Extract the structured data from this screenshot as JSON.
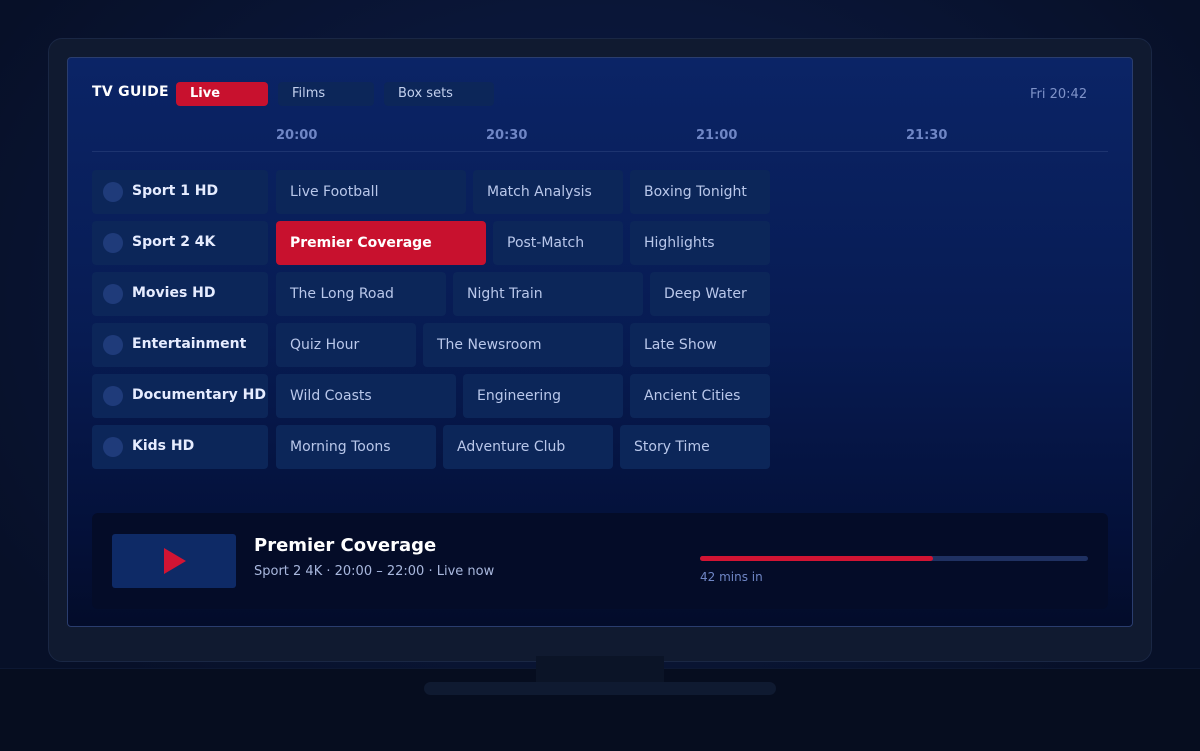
{
  "guide": {
    "title": "TV GUIDE",
    "tabs": [
      {
        "label": "Live",
        "active": true
      },
      {
        "label": "Films",
        "active": false
      },
      {
        "label": "Box sets",
        "active": false
      }
    ],
    "clock": "Fri 20:42"
  },
  "timeline": [
    "20:00",
    "20:30",
    "21:00",
    "21:30"
  ],
  "channels": [
    {
      "name": "Sport 1 HD",
      "programs": [
        "Live Football",
        "Match Analysis",
        "Boxing Tonight"
      ]
    },
    {
      "name": "Sport 2 4K",
      "programs": [
        "Premier Coverage",
        "Post-Match",
        "Highlights"
      ]
    },
    {
      "name": "Movies HD",
      "programs": [
        "The Long Road",
        "Night Train",
        "Deep Water"
      ]
    },
    {
      "name": "Entertainment",
      "programs": [
        "Quiz Hour",
        "The Newsroom",
        "Late Show"
      ]
    },
    {
      "name": "Documentary HD",
      "programs": [
        "Wild Coasts",
        "Engineering",
        "Ancient Cities"
      ]
    },
    {
      "name": "Kids HD",
      "programs": [
        "Morning Toons",
        "Adventure Club",
        "Story Time"
      ]
    }
  ],
  "selected": {
    "channel": 1,
    "program": 0
  },
  "now_playing": {
    "title": "Premier Coverage",
    "meta": "Sport 2 4K · 20:00 – 22:00 · Live now",
    "progress_fraction": 0.6,
    "progress_label": "42 mins in",
    "thumb_icon": "play-icon"
  },
  "colors": {
    "accent": "#c8112e",
    "tile": "#0c2659",
    "text_muted": "#6f86c5"
  }
}
